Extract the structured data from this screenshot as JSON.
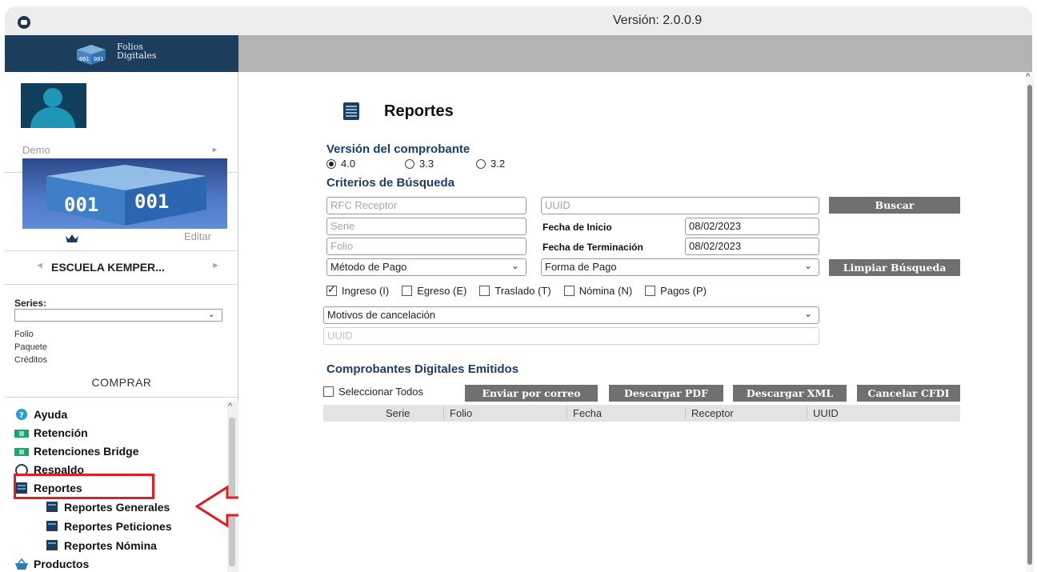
{
  "window": {
    "version_text": "Versión: 2.0.0.9"
  },
  "brand": {
    "logo_line1": "Folios",
    "logo_line2": "Digitales"
  },
  "sidebar": {
    "demo_label": "Demo",
    "editar_label": "Editar",
    "company_name": "ESCUELA KEMPER...",
    "series_label": "Series:",
    "series_value": "",
    "stats": [
      "Folio",
      "Paquete",
      "Créditos"
    ],
    "comprar_label": "COMPRAR",
    "tree": [
      {
        "label": "Ayuda",
        "icon": "help-icon"
      },
      {
        "label": "Retención",
        "icon": "money-icon"
      },
      {
        "label": "Retenciones Bridge",
        "icon": "money-icon"
      },
      {
        "label": "Respaldo",
        "icon": "backup-icon"
      },
      {
        "label": "Reportes",
        "icon": "report-icon"
      },
      {
        "label": "Reportes Generales",
        "icon": "report-icon"
      },
      {
        "label": "Reportes Peticiones",
        "icon": "report-icon"
      },
      {
        "label": "Reportes Nómina",
        "icon": "report-icon"
      },
      {
        "label": "Productos",
        "icon": "basket-icon"
      }
    ]
  },
  "main": {
    "title": "Reportes",
    "version_section": "Versión del comprobante",
    "versions": [
      {
        "label": "4.0",
        "selected": true
      },
      {
        "label": "3.3",
        "selected": false
      },
      {
        "label": "3.2",
        "selected": false
      }
    ],
    "criteria_section": "Criterios de Búsqueda",
    "fields": {
      "rfc_placeholder": "RFC Receptor",
      "uuid_placeholder": "UUID",
      "serie_placeholder": "Serie",
      "folio_placeholder": "Folio",
      "fecha_inicio_label": "Fecha de Inicio",
      "fecha_inicio_value": "08/02/2023",
      "fecha_fin_label": "Fecha de Terminación",
      "fecha_fin_value": "08/02/2023",
      "metodo_pago": "Método de Pago",
      "forma_pago": "Forma de Pago",
      "motivos": "Motivos de cancelación",
      "uuid2_placeholder": "UUID"
    },
    "buttons": {
      "buscar": "Buscar",
      "limpiar": "Limpiar Búsqueda",
      "enviar": "Enviar por correo",
      "pdf": "Descargar PDF",
      "xml": "Descargar XML",
      "cancelar": "Cancelar CFDI"
    },
    "types": [
      {
        "label": "Ingreso (I)",
        "checked": true
      },
      {
        "label": "Egreso (E)",
        "checked": false
      },
      {
        "label": "Traslado (T)",
        "checked": false
      },
      {
        "label": "Nómina (N)",
        "checked": false
      },
      {
        "label": "Pagos (P)",
        "checked": false
      }
    ],
    "emitted_section": "Comprobantes Digitales Emitidos",
    "select_all": "Seleccionar Todos",
    "table_columns": [
      "Serie",
      "Folio",
      "Fecha",
      "Receptor",
      "UUID"
    ]
  },
  "colors": {
    "nav": "#1d3d5c",
    "accent_title": "#1d3d6c",
    "button": "#707070",
    "highlight": "#e11d22"
  }
}
